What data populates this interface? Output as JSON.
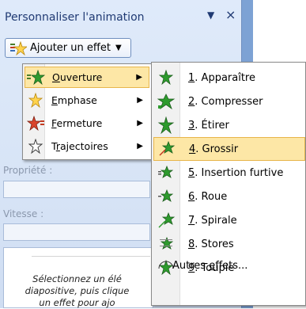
{
  "pane": {
    "title": "Personnaliser l'animation",
    "close_glyph": "×",
    "dropdown_glyph": "▼"
  },
  "add_effect": {
    "label": "Ajouter un effet",
    "arrow": "▼"
  },
  "fields": {
    "property_label": "Propriété :",
    "speed_label": "Vitesse :"
  },
  "note": {
    "line1": "Sélectionnez un élé",
    "line2": "diapositive, puis clique",
    "line3": "un effet pour ajo"
  },
  "menu1": {
    "items": [
      {
        "pre": "",
        "ak": "O",
        "post": "uverture",
        "icon": "green-star-icon",
        "selected": true
      },
      {
        "pre": "",
        "ak": "E",
        "post": "mphase",
        "icon": "yellow-star-icon",
        "selected": false
      },
      {
        "pre": "",
        "ak": "F",
        "post": "ermeture",
        "icon": "red-star-icon",
        "selected": false
      },
      {
        "pre": "T",
        "ak": "r",
        "post": "ajectoires",
        "icon": "outline-star-icon",
        "selected": false
      }
    ],
    "submenu_glyph": "▶"
  },
  "menu2": {
    "items": [
      {
        "ak": "1",
        "text": ". Apparaître",
        "icon": "appear-star-icon"
      },
      {
        "ak": "2",
        "text": ". Compresser",
        "icon": "compress-star-icon"
      },
      {
        "ak": "3",
        "text": ". Étirer",
        "icon": "stretch-star-icon"
      },
      {
        "ak": "4",
        "text": ". Grossir",
        "icon": "grow-star-icon",
        "selected": true
      },
      {
        "ak": "5",
        "text": ". Insertion furtive",
        "icon": "crawl-star-icon"
      },
      {
        "ak": "6",
        "text": ". Roue",
        "icon": "wheel-star-icon"
      },
      {
        "ak": "7",
        "text": ". Spirale",
        "icon": "spiral-star-icon"
      },
      {
        "ak": "8",
        "text": ". Stores",
        "icon": "blinds-star-icon"
      },
      {
        "ak": "9",
        "text": ". Toupie",
        "icon": "spin-star-icon"
      }
    ],
    "more_pre": "Autres ",
    "more_ak": "e",
    "more_post": "ffets..."
  },
  "colors": {
    "highlight": "#fde7a6",
    "highlight_border": "#e7b54b",
    "pane_title": "#1f3a73"
  }
}
